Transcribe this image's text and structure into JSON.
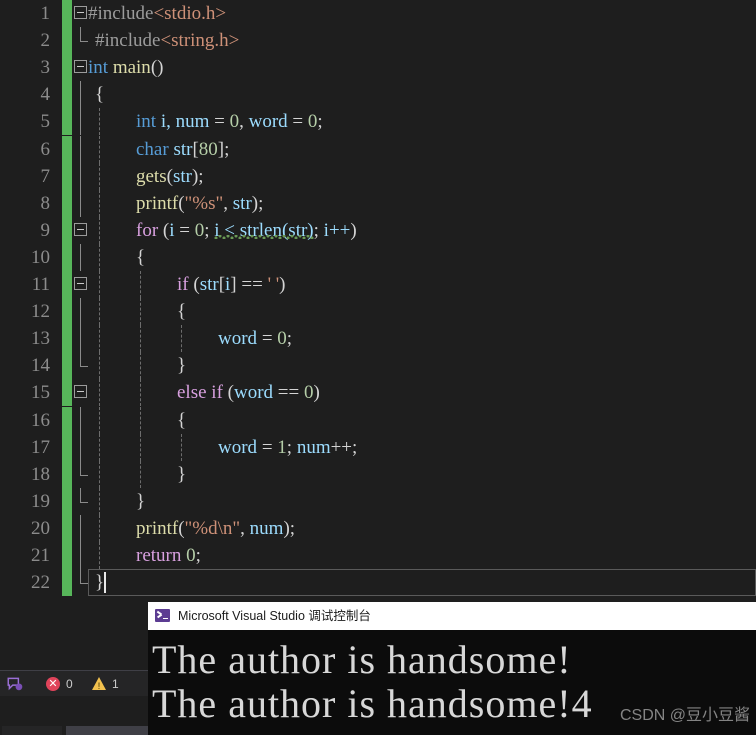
{
  "app": {
    "name": "Visual Studio Code Editor"
  },
  "editor": {
    "language": "c",
    "lines": [
      {
        "n": "1",
        "text": "#include<stdio.h>"
      },
      {
        "n": "2",
        "text": "#include<string.h>"
      },
      {
        "n": "3",
        "text": "int main()"
      },
      {
        "n": "4",
        "text": "{"
      },
      {
        "n": "5",
        "text": "    int i, num = 0, word = 0;"
      },
      {
        "n": "6",
        "text": "    char str[80];"
      },
      {
        "n": "7",
        "text": "    gets(str);"
      },
      {
        "n": "8",
        "text": "    printf(\"%s\", str);"
      },
      {
        "n": "9",
        "text": "    for (i = 0; i < strlen(str); i++)"
      },
      {
        "n": "10",
        "text": "    {"
      },
      {
        "n": "11",
        "text": "        if (str[i] == ' ')"
      },
      {
        "n": "12",
        "text": "        {"
      },
      {
        "n": "13",
        "text": "            word = 0;"
      },
      {
        "n": "14",
        "text": "        }"
      },
      {
        "n": "15",
        "text": "        else if (word == 0)"
      },
      {
        "n": "16",
        "text": "        {"
      },
      {
        "n": "17",
        "text": "            word = 1; num++;"
      },
      {
        "n": "18",
        "text": "        }"
      },
      {
        "n": "19",
        "text": "    }"
      },
      {
        "n": "20",
        "text": "    printf(\"%d\\n\", num);"
      },
      {
        "n": "21",
        "text": "    return 0;"
      },
      {
        "n": "22",
        "text": "}"
      }
    ],
    "tokens": {
      "l1": {
        "pp": "#include",
        "inc": "<stdio.h>"
      },
      "l2": {
        "pp": "#include",
        "inc": "<string.h>"
      },
      "l3": {
        "kw": "int",
        "fn": "main",
        "pun": "()"
      },
      "l4": {
        "brace": "{"
      },
      "l5": {
        "kw": "int",
        "a": " i, ",
        "id1": "num",
        "b": " = ",
        "n1": "0",
        "c": ", ",
        "id2": "word",
        "d": " = ",
        "n2": "0",
        "e": ";"
      },
      "l6": {
        "kw": "char",
        "id": " str",
        "lb": "[",
        "n": "80",
        "rb": "]",
        "sc": ";"
      },
      "l7": {
        "fn": "gets",
        "p1": "(",
        "id": "str",
        "p2": ");"
      },
      "l8": {
        "fn": "printf",
        "p1": "(",
        "str": "\"%s\"",
        "c": ", ",
        "id": "str",
        "p2": ");"
      },
      "l9": {
        "ctl": "for",
        "p1": " (",
        "id1": "i",
        "eq": " = ",
        "n1": "0",
        "sc": "; ",
        "cond": "i < strlen(str)",
        "sc2": "; ",
        "inc": "i++",
        "p2": ")"
      },
      "l11": {
        "ctl": "if",
        "p1": " (",
        "id": "str",
        "lb": "[",
        "i": "i",
        "rb": "]",
        "op": " == ",
        "ch": "' '",
        "p2": ")"
      },
      "l13": {
        "id": "word",
        "eq": " = ",
        "n": "0",
        "sc": ";"
      },
      "l15": {
        "ctl1": "else",
        "sp": " ",
        "ctl2": "if",
        "p1": " (",
        "id": "word",
        "op": " == ",
        "n": "0",
        "p2": ")"
      },
      "l17": {
        "id1": "word",
        "eq": " = ",
        "n1": "1",
        "sc": "; ",
        "id2": "num",
        "pp": "++",
        "sc2": ";"
      },
      "l20": {
        "fn": "printf",
        "p1": "(",
        "str": "\"%d\\n\"",
        "c": ", ",
        "id": "num",
        "p2": ");"
      },
      "l21": {
        "ctl": "return",
        "sp": " ",
        "n": "0",
        "sc": ";"
      }
    }
  },
  "status": {
    "error_icon": "error-circle-icon",
    "error_count": "0",
    "warning_icon": "warning-triangle-icon",
    "warning_count": "1",
    "left_icon": "feedback-icon"
  },
  "console": {
    "icon": "console-app-icon",
    "title": "Microsoft Visual Studio 调试控制台",
    "output": [
      "The author is handsome!",
      "The author is handsome!4"
    ]
  },
  "watermark": {
    "text": "CSDN @豆小豆酱"
  },
  "colors": {
    "editor_bg": "#1e1e1e",
    "console_bg": "#0c0c0c",
    "change_bar": "#57b65a",
    "keyword": "#569cd6",
    "control": "#d8a0df",
    "function": "#dcdcaa",
    "identifier": "#9cdcfe",
    "number": "#b5cea8",
    "string": "#ce9178",
    "preprocessor": "#9b9b9b",
    "squiggle": "#6a9955",
    "error": "#e0435a",
    "warning": "#f2c14e"
  }
}
